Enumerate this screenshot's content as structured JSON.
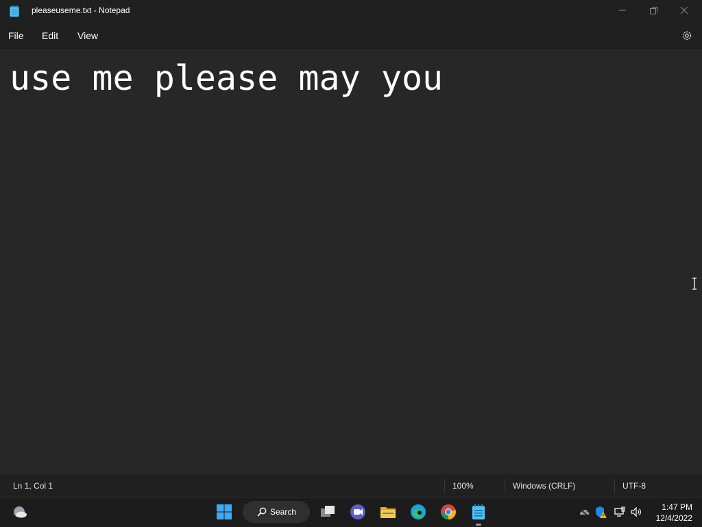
{
  "window": {
    "title": "pleaseuseme.txt - Notepad",
    "icon": "notepad-icon",
    "controls": [
      "minimize-icon",
      "maximize-icon",
      "close-icon"
    ]
  },
  "menu": {
    "file": "File",
    "edit": "Edit",
    "view": "View",
    "settings_icon": "gear-icon"
  },
  "editor": {
    "content": "use me please may you"
  },
  "status": {
    "position": "Ln 1, Col 1",
    "zoom": "100%",
    "line_ending": "Windows (CRLF)",
    "encoding": "UTF-8"
  },
  "taskbar": {
    "search_label": "Search",
    "apps": [
      "weather-icon",
      "start-icon",
      "search-icon",
      "task-view-icon",
      "teams-icon",
      "file-explorer-icon",
      "edge-icon",
      "chrome-icon",
      "notepad-icon"
    ],
    "tray": [
      "onedrive-icon",
      "security-warning-icon",
      "network-icon",
      "volume-icon"
    ],
    "time": "1:47 PM",
    "date": "12/4/2022"
  },
  "colors": {
    "background": "#272727",
    "chrome": "#202020",
    "taskbar": "#1c1c1c",
    "text": "#ffffff"
  }
}
